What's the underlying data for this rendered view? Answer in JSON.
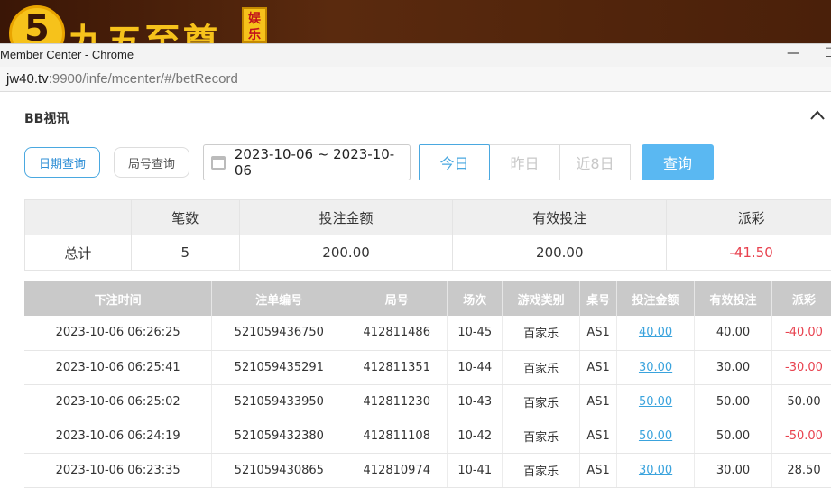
{
  "banner": {
    "logo_number": "5",
    "logo_text": "九五至尊",
    "logo_badge": "娱乐"
  },
  "window": {
    "title": "Member Center - Chrome",
    "minimize": "—",
    "maximize": "☐"
  },
  "address": {
    "host": "jw40.tv",
    "rest": ":9900/infe/mcenter/#/betRecord"
  },
  "section": {
    "title": "BB视讯",
    "collapse_icon": "chevron-up-icon"
  },
  "filters": {
    "date_tab": "日期查询",
    "round_tab": "局号查询",
    "date_range": "2023-10-06 ~ 2023-10-06",
    "quick_ranges": [
      "今日",
      "昨日",
      "近8日"
    ],
    "query_button": "查询"
  },
  "summary": {
    "headers": [
      "",
      "笔数",
      "投注金额",
      "有效投注",
      "派彩"
    ],
    "row": [
      "总计",
      "5",
      "200.00",
      "200.00",
      "-41.50"
    ]
  },
  "records": {
    "headers": [
      "下注时间",
      "注单编号",
      "局号",
      "场次",
      "游戏类别",
      "桌号",
      "投注金额",
      "有效投注",
      "派彩"
    ],
    "rows": [
      [
        "2023-10-06 06:26:25",
        "521059436750",
        "412811486",
        "10-45",
        "百家乐",
        "AS1",
        "40.00",
        "40.00",
        "-40.00"
      ],
      [
        "2023-10-06 06:25:41",
        "521059435291",
        "412811351",
        "10-44",
        "百家乐",
        "AS1",
        "30.00",
        "30.00",
        "-30.00"
      ],
      [
        "2023-10-06 06:25:02",
        "521059433950",
        "412811230",
        "10-43",
        "百家乐",
        "AS1",
        "50.00",
        "50.00",
        "50.00"
      ],
      [
        "2023-10-06 06:24:19",
        "521059432380",
        "412811108",
        "10-42",
        "百家乐",
        "AS1",
        "50.00",
        "50.00",
        "-50.00"
      ],
      [
        "2023-10-06 06:23:35",
        "521059430865",
        "412810974",
        "10-41",
        "百家乐",
        "AS1",
        "30.00",
        "30.00",
        "28.50"
      ]
    ]
  },
  "colors": {
    "accent": "#4aa8e0",
    "query_bg": "#5ab8f2",
    "negative": "#e8424f",
    "header_bg": "#c9c9c9"
  }
}
